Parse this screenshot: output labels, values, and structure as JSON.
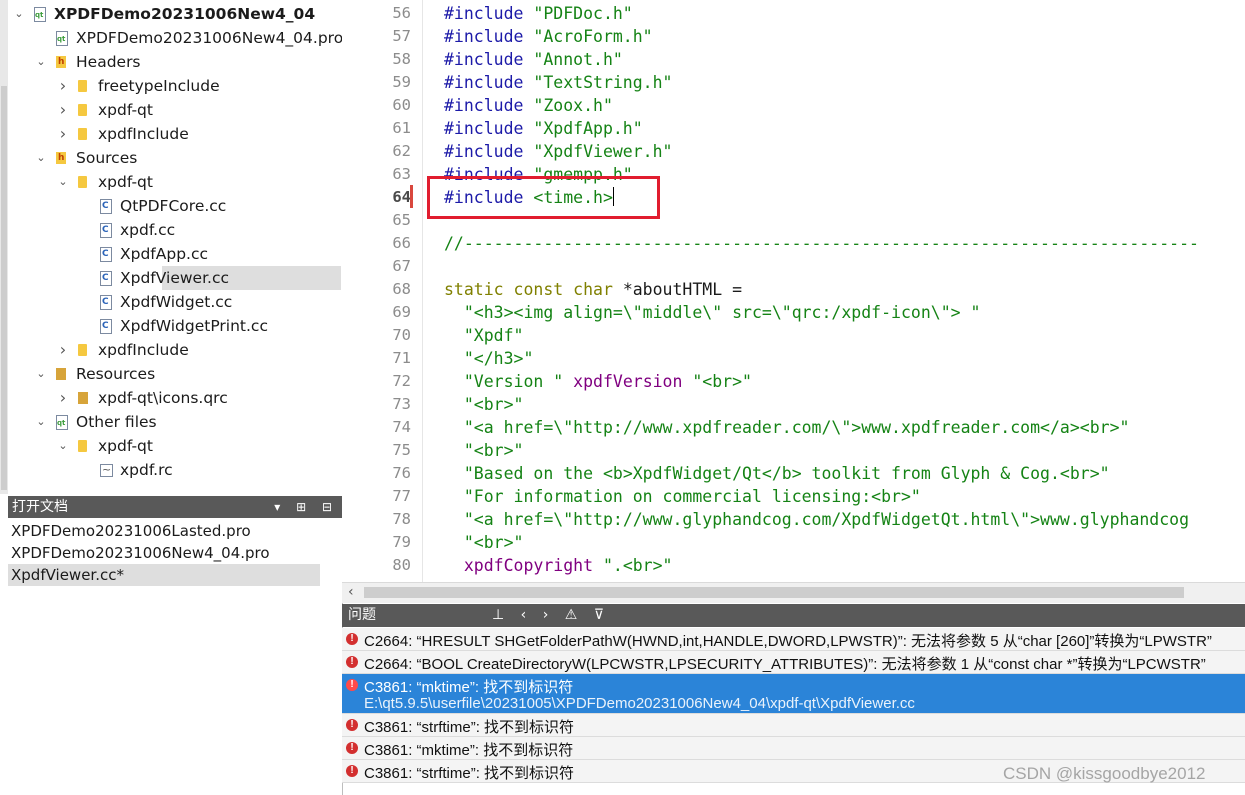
{
  "tree": [
    {
      "label": "XPDFDemo20231006New4_04",
      "indent": 0,
      "arrow": "down",
      "icon": "project-icon",
      "bold": true
    },
    {
      "label": "XPDFDemo20231006New4_04.pro",
      "indent": 1,
      "arrow": "",
      "icon": "pro-file-icon"
    },
    {
      "label": "Headers",
      "indent": 1,
      "arrow": "down",
      "icon": "headers-folder-icon"
    },
    {
      "label": "freetypeInclude",
      "indent": 2,
      "arrow": "right",
      "icon": "folder-icon"
    },
    {
      "label": "xpdf-qt",
      "indent": 2,
      "arrow": "right",
      "icon": "folder-icon"
    },
    {
      "label": "xpdfInclude",
      "indent": 2,
      "arrow": "right",
      "icon": "folder-icon"
    },
    {
      "label": "Sources",
      "indent": 1,
      "arrow": "down",
      "icon": "sources-folder-icon"
    },
    {
      "label": "xpdf-qt",
      "indent": 2,
      "arrow": "down",
      "icon": "folder-icon"
    },
    {
      "label": "QtPDFCore.cc",
      "indent": 3,
      "arrow": "",
      "icon": "cpp-file-icon"
    },
    {
      "label": "xpdf.cc",
      "indent": 3,
      "arrow": "",
      "icon": "cpp-file-icon"
    },
    {
      "label": "XpdfApp.cc",
      "indent": 3,
      "arrow": "",
      "icon": "cpp-file-icon"
    },
    {
      "label": "XpdfViewer.cc",
      "indent": 3,
      "arrow": "",
      "icon": "cpp-file-icon",
      "selected": true
    },
    {
      "label": "XpdfWidget.cc",
      "indent": 3,
      "arrow": "",
      "icon": "cpp-file-icon"
    },
    {
      "label": "XpdfWidgetPrint.cc",
      "indent": 3,
      "arrow": "",
      "icon": "cpp-file-icon"
    },
    {
      "label": "xpdfInclude",
      "indent": 2,
      "arrow": "right",
      "icon": "folder-icon"
    },
    {
      "label": "Resources",
      "indent": 1,
      "arrow": "down",
      "icon": "resources-folder-icon"
    },
    {
      "label": "xpdf-qt\\icons.qrc",
      "indent": 2,
      "arrow": "right",
      "icon": "qrc-file-icon"
    },
    {
      "label": "Other files",
      "indent": 1,
      "arrow": "down",
      "icon": "other-files-icon"
    },
    {
      "label": "xpdf-qt",
      "indent": 2,
      "arrow": "down",
      "icon": "folder-icon"
    },
    {
      "label": "xpdf.rc",
      "indent": 3,
      "arrow": "",
      "icon": "rc-file-icon"
    }
  ],
  "open_docs": {
    "title": "打开文档",
    "buttons": "▾ ⊞ ⊟",
    "items": [
      {
        "label": "XPDFDemo20231006Lasted.pro"
      },
      {
        "label": "XPDFDemo20231006New4_04.pro"
      },
      {
        "label": "XpdfViewer.cc*",
        "selected": true
      }
    ]
  },
  "editor": {
    "line_numbers": [
      "56",
      "57",
      "58",
      "59",
      "60",
      "61",
      "62",
      "63",
      "64",
      "65",
      "66",
      "67",
      "68",
      "69",
      "70",
      "71",
      "72",
      "73",
      "74",
      "75",
      "76",
      "77",
      "78",
      "79",
      "80"
    ],
    "current_line": "64",
    "lines": [
      {
        "parts": [
          {
            "c": "pp",
            "t": "#include "
          },
          {
            "c": "str",
            "t": "\"PDFDoc.h\""
          }
        ]
      },
      {
        "parts": [
          {
            "c": "pp",
            "t": "#include "
          },
          {
            "c": "str",
            "t": "\"AcroForm.h\""
          }
        ]
      },
      {
        "parts": [
          {
            "c": "pp",
            "t": "#include "
          },
          {
            "c": "str",
            "t": "\"Annot.h\""
          }
        ]
      },
      {
        "parts": [
          {
            "c": "pp",
            "t": "#include "
          },
          {
            "c": "str",
            "t": "\"TextString.h\""
          }
        ]
      },
      {
        "parts": [
          {
            "c": "pp",
            "t": "#include "
          },
          {
            "c": "str",
            "t": "\"Zoox.h\""
          }
        ]
      },
      {
        "parts": [
          {
            "c": "pp",
            "t": "#include "
          },
          {
            "c": "str",
            "t": "\"XpdfApp.h\""
          }
        ]
      },
      {
        "parts": [
          {
            "c": "pp",
            "t": "#include "
          },
          {
            "c": "str",
            "t": "\"XpdfViewer.h\""
          }
        ]
      },
      {
        "parts": [
          {
            "c": "pp",
            "t": "#include "
          },
          {
            "c": "str",
            "t": "\"gmempp.h\""
          }
        ]
      },
      {
        "parts": [
          {
            "c": "pp",
            "t": "#include "
          },
          {
            "c": "str",
            "t": "<time.h>"
          }
        ],
        "caret": true
      },
      {
        "parts": []
      },
      {
        "parts": [
          {
            "c": "cm",
            "t": "//--------------------------------------------------------------------------"
          }
        ]
      },
      {
        "parts": []
      },
      {
        "parts": [
          {
            "c": "kw",
            "t": "static const char "
          },
          {
            "c": "",
            "t": "*aboutHTML ="
          }
        ]
      },
      {
        "parts": [
          {
            "c": "",
            "t": "  "
          },
          {
            "c": "str",
            "t": "\"<h3><img align=\\\"middle\\\" src=\\\"qrc:/xpdf-icon\\\"> \""
          }
        ]
      },
      {
        "parts": [
          {
            "c": "",
            "t": "  "
          },
          {
            "c": "str",
            "t": "\"Xpdf\""
          }
        ]
      },
      {
        "parts": [
          {
            "c": "",
            "t": "  "
          },
          {
            "c": "str",
            "t": "\"</h3>\""
          }
        ]
      },
      {
        "parts": [
          {
            "c": "",
            "t": "  "
          },
          {
            "c": "str",
            "t": "\"Version \" "
          },
          {
            "c": "id",
            "t": "xpdfVersion"
          },
          {
            "c": "str",
            "t": " \"<br>\""
          }
        ]
      },
      {
        "parts": [
          {
            "c": "",
            "t": "  "
          },
          {
            "c": "str",
            "t": "\"<br>\""
          }
        ]
      },
      {
        "parts": [
          {
            "c": "",
            "t": "  "
          },
          {
            "c": "str",
            "t": "\"<a href=\\\"http://www.xpdfreader.com/\\\">www.xpdfreader.com</a><br>\""
          }
        ]
      },
      {
        "parts": [
          {
            "c": "",
            "t": "  "
          },
          {
            "c": "str",
            "t": "\"<br>\""
          }
        ]
      },
      {
        "parts": [
          {
            "c": "",
            "t": "  "
          },
          {
            "c": "str",
            "t": "\"Based on the <b>XpdfWidget/Qt</b> toolkit from Glyph & Cog.<br>\""
          }
        ]
      },
      {
        "parts": [
          {
            "c": "",
            "t": "  "
          },
          {
            "c": "str",
            "t": "\"For information on commercial licensing:<br>\""
          }
        ]
      },
      {
        "parts": [
          {
            "c": "",
            "t": "  "
          },
          {
            "c": "str",
            "t": "\"<a href=\\\"http://www.glyphandcog.com/XpdfWidgetQt.html\\\">www.glyphandcog"
          }
        ]
      },
      {
        "parts": [
          {
            "c": "",
            "t": "  "
          },
          {
            "c": "str",
            "t": "\"<br>\""
          }
        ]
      },
      {
        "parts": [
          {
            "c": "",
            "t": "  "
          },
          {
            "c": "id",
            "t": "xpdfCopyright"
          },
          {
            "c": "str",
            "t": " \".<br>\""
          }
        ]
      }
    ]
  },
  "issues": {
    "title": "问题",
    "tools": "⊥ ‹ › ⚠ ⊽",
    "rows": [
      {
        "message": "C2664: “HRESULT SHGetFolderPathW(HWND,int,HANDLE,DWORD,LPWSTR)”: 无法将参数 5 从“char [260]”转换为“LPWSTR”"
      },
      {
        "message": "C2664: “BOOL CreateDirectoryW(LPCWSTR,LPSECURITY_ATTRIBUTES)”: 无法将参数 1 从“const char *”转换为“LPCWSTR”"
      },
      {
        "message": "C3861: “mktime”: 找不到标识符",
        "path": "E:\\qt5.9.5\\userfile\\20231005\\XPDFDemo20231006New4_04\\xpdf-qt\\XpdfViewer.cc",
        "selected": true
      },
      {
        "message": "C3861: “strftime”: 找不到标识符"
      },
      {
        "message": "C3861: “mktime”: 找不到标识符"
      },
      {
        "message": "C3861: “strftime”: 找不到标识符"
      }
    ]
  },
  "watermark": "CSDN @kissgoodbye2012"
}
